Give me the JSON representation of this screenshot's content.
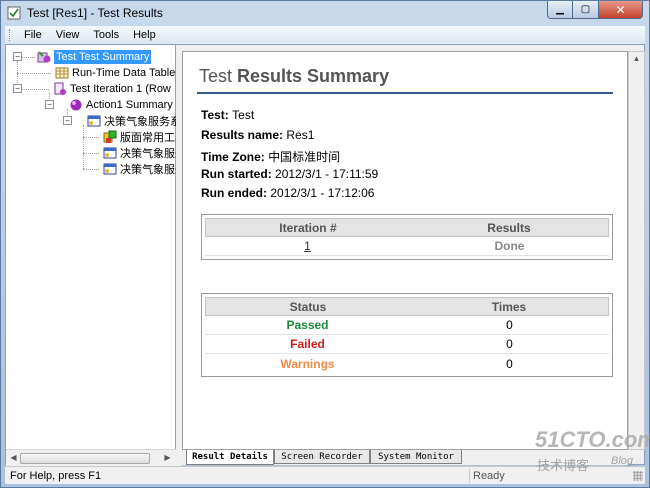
{
  "window": {
    "title": "Test [Res1] - Test Results"
  },
  "menu": {
    "items": [
      {
        "label": "File"
      },
      {
        "label": "View"
      },
      {
        "label": "Tools"
      },
      {
        "label": "Help"
      }
    ]
  },
  "tree": {
    "nodes": [
      {
        "label": "Test Test Summary",
        "icon": "summary-icon",
        "selected": true
      },
      {
        "label": "Run-Time Data Table",
        "icon": "datatable-icon"
      },
      {
        "label": "Test Iteration 1 (Row",
        "icon": "iteration-icon"
      },
      {
        "label": "Action1 Summary",
        "icon": "action-icon"
      },
      {
        "label": "决策气象服务系统",
        "icon": "browser-icon"
      },
      {
        "label": "版面常用工具",
        "icon": "page-icon"
      },
      {
        "label": "决策气象服务",
        "icon": "browser-icon"
      },
      {
        "label": "决策气象服务",
        "icon": "browser-icon"
      }
    ]
  },
  "report": {
    "title_light": "Test ",
    "title_bold": "Results Summary",
    "fields": [
      {
        "key": "Test",
        "value": "Test"
      },
      {
        "key": "Results name",
        "value": "Res1"
      },
      {
        "key": "Time Zone",
        "value": "中国标准时间"
      },
      {
        "key": "Run started",
        "value": "2012/3/1 - 17:11:59"
      },
      {
        "key": "Run ended",
        "value": "2012/3/1 - 17:12:06"
      }
    ],
    "iterations": {
      "headers": [
        "Iteration #",
        "Results"
      ],
      "rows": [
        {
          "iteration": "1",
          "result": "Done"
        }
      ]
    },
    "status": {
      "headers": [
        "Status",
        "Times"
      ],
      "rows": [
        {
          "status": "Passed",
          "times": "0"
        },
        {
          "status": "Failed",
          "times": "0"
        },
        {
          "status": "Warnings",
          "times": "0"
        }
      ]
    }
  },
  "tabs": [
    {
      "label": "Result Details",
      "active": true
    },
    {
      "label": "Screen Recorder"
    },
    {
      "label": "System Monitor"
    }
  ],
  "status": {
    "left": "For Help, press F1",
    "right": "Ready"
  },
  "watermark": {
    "brand": "51CTO.com",
    "sub": "技术博客",
    "blog": "Blog"
  },
  "colors": {
    "passed": "#1a8a3a",
    "failed": "#d41b1b",
    "warnings": "#f08c4a",
    "selection": "#3399ff",
    "title_rule": "#3a5a8a"
  }
}
